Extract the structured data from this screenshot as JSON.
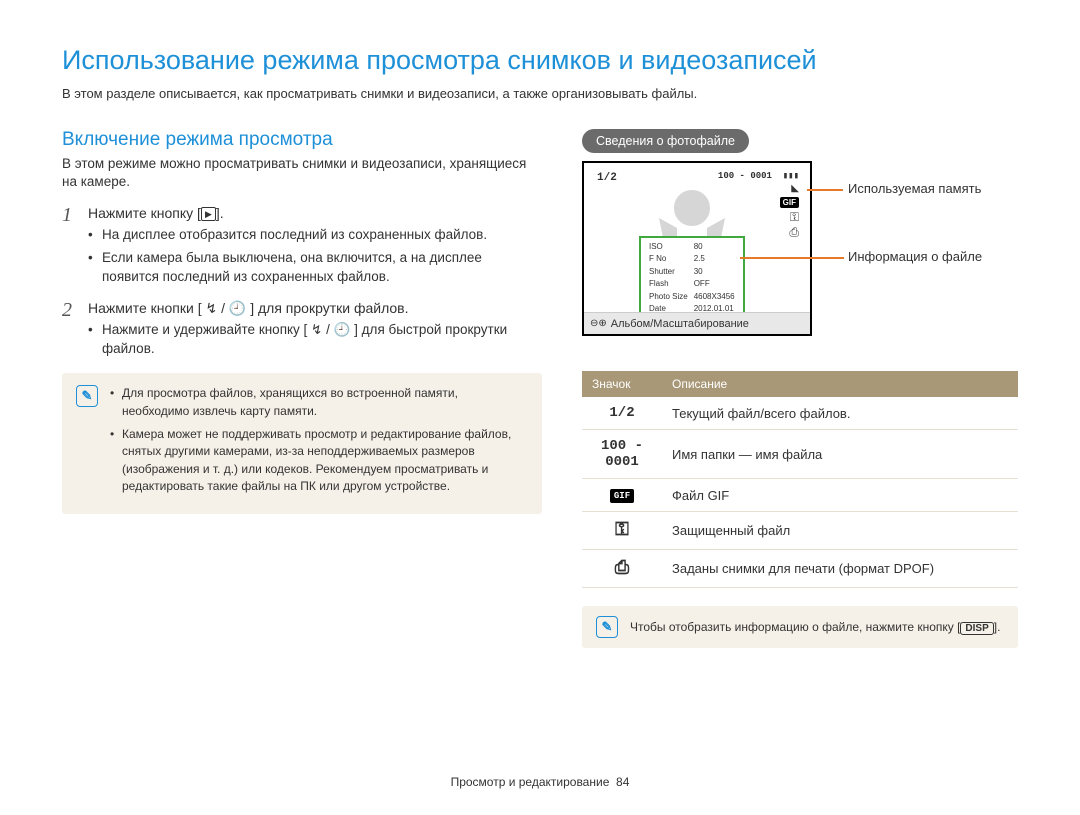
{
  "title": "Использование режима просмотра снимков и видеозаписей",
  "intro": "В этом разделе описывается, как просматривать снимки и видеозаписи, а также организовывать файлы.",
  "left": {
    "heading": "Включение режима просмотра",
    "para": "В этом режиме можно просматривать снимки и видеозаписи, хранящиеся на камере.",
    "step1": {
      "num": "1",
      "label_pre": "Нажмите кнопку [",
      "label_icon": "▶",
      "label_post": "].",
      "bullets": [
        "На дисплее отобразится последний из сохраненных файлов.",
        "Если камера была выключена, она включится, а на дисплее появится последний из сохраненных файлов."
      ]
    },
    "step2": {
      "num": "2",
      "label": "Нажмите кнопки [ ↯ / 🕘 ] для прокрутки файлов.",
      "bullets": [
        "Нажмите и удерживайте кнопку [ ↯ / 🕘 ] для быстрой прокрутки файлов."
      ]
    },
    "note": [
      "Для просмотра файлов, хранящихся во встроенной памяти, необходимо извлечь карту памяти.",
      "Камера может не поддерживать просмотр и редактирование файлов, снятых другими камерами, из-за неподдерживаемых размеров (изображения и т. д.) или кодеков. Рекомендуем просматривать и редактировать такие файлы на ПК или другом устройстве."
    ]
  },
  "right": {
    "pill": "Сведения о фотофайле",
    "screen": {
      "counter": "1/2",
      "folder_file": "100 - 0001",
      "gif": "GIF",
      "info": {
        "iso_l": "ISO",
        "iso_v": "80",
        "fno_l": "F No",
        "fno_v": "2.5",
        "sh_l": "Shutter",
        "sh_v": "30",
        "fl_l": "Flash",
        "fl_v": "OFF",
        "ps_l": "Photo Size",
        "ps_v": "4608X3456",
        "dt_l": "Date",
        "dt_v": "2012.01.01"
      },
      "footer": "Альбом/Масштабирование"
    },
    "callout1": "Используемая память",
    "callout2": "Информация о файле",
    "table": {
      "h1": "Значок",
      "h2": "Описание",
      "rows": [
        {
          "icon": "1/2",
          "desc": "Текущий файл/всего файлов.",
          "kind": "text"
        },
        {
          "icon": "100 - 0001",
          "desc": "Имя папки — имя файла",
          "kind": "text"
        },
        {
          "icon": "GIF",
          "desc": "Файл GIF",
          "kind": "gif"
        },
        {
          "icon": "key",
          "desc": "Защищенный файл",
          "kind": "key"
        },
        {
          "icon": "printer",
          "desc": "Заданы снимки для печати (формат DPOF)",
          "kind": "printer"
        }
      ]
    },
    "note2_pre": "Чтобы отобразить информацию о файле, нажмите кнопку [",
    "note2_btn": "DISP",
    "note2_post": "]."
  },
  "footer": {
    "text": "Просмотр и редактирование",
    "page": "84"
  }
}
